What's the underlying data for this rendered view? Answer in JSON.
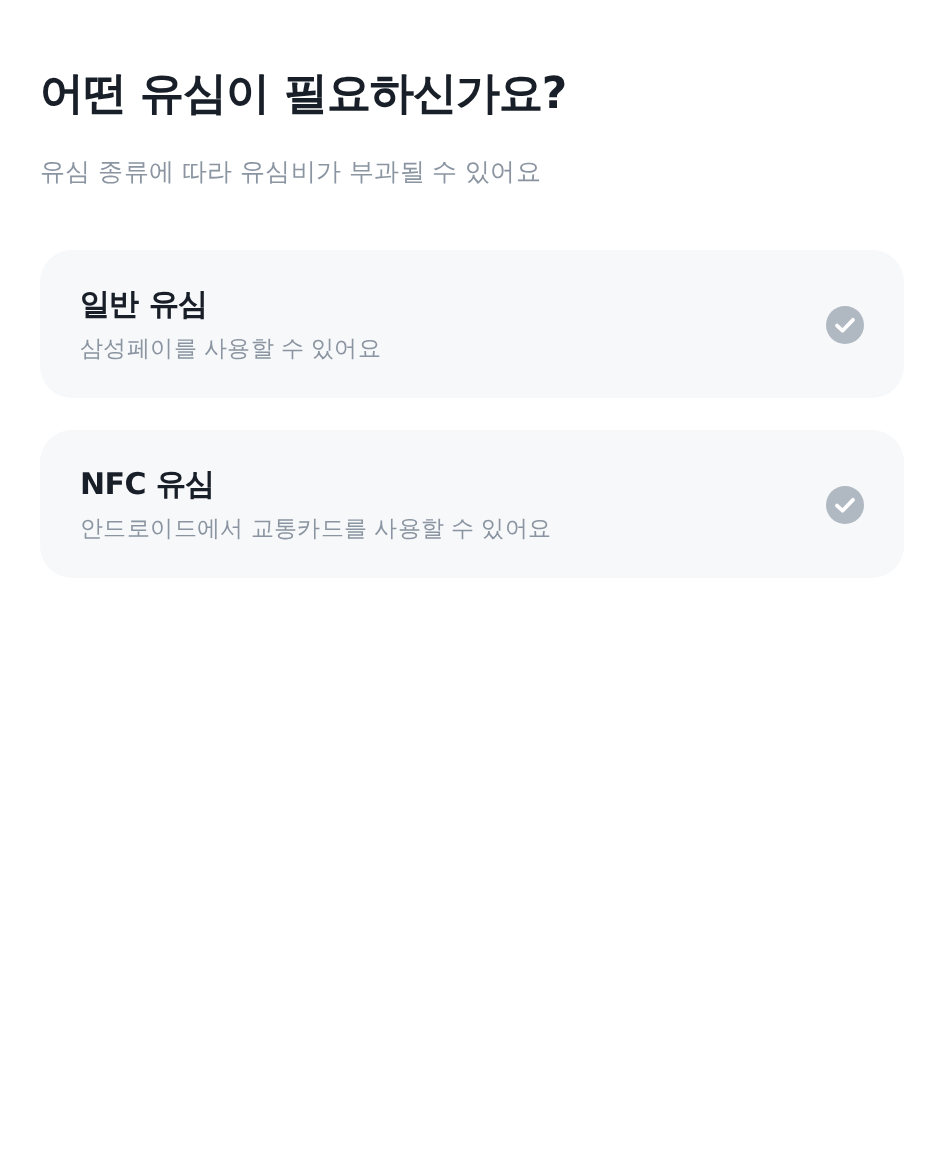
{
  "title": "어떤 유심이 필요하신가요?",
  "subtitle": "유심 종류에 따라 유심비가 부과될 수 있어요",
  "options": [
    {
      "name": "일반 유심",
      "description": "삼성페이를 사용할 수 있어요",
      "selected": false
    },
    {
      "name": "NFC 유심",
      "description": "안드로이드에서 교통카드를 사용할 수 있어요",
      "selected": false
    }
  ]
}
